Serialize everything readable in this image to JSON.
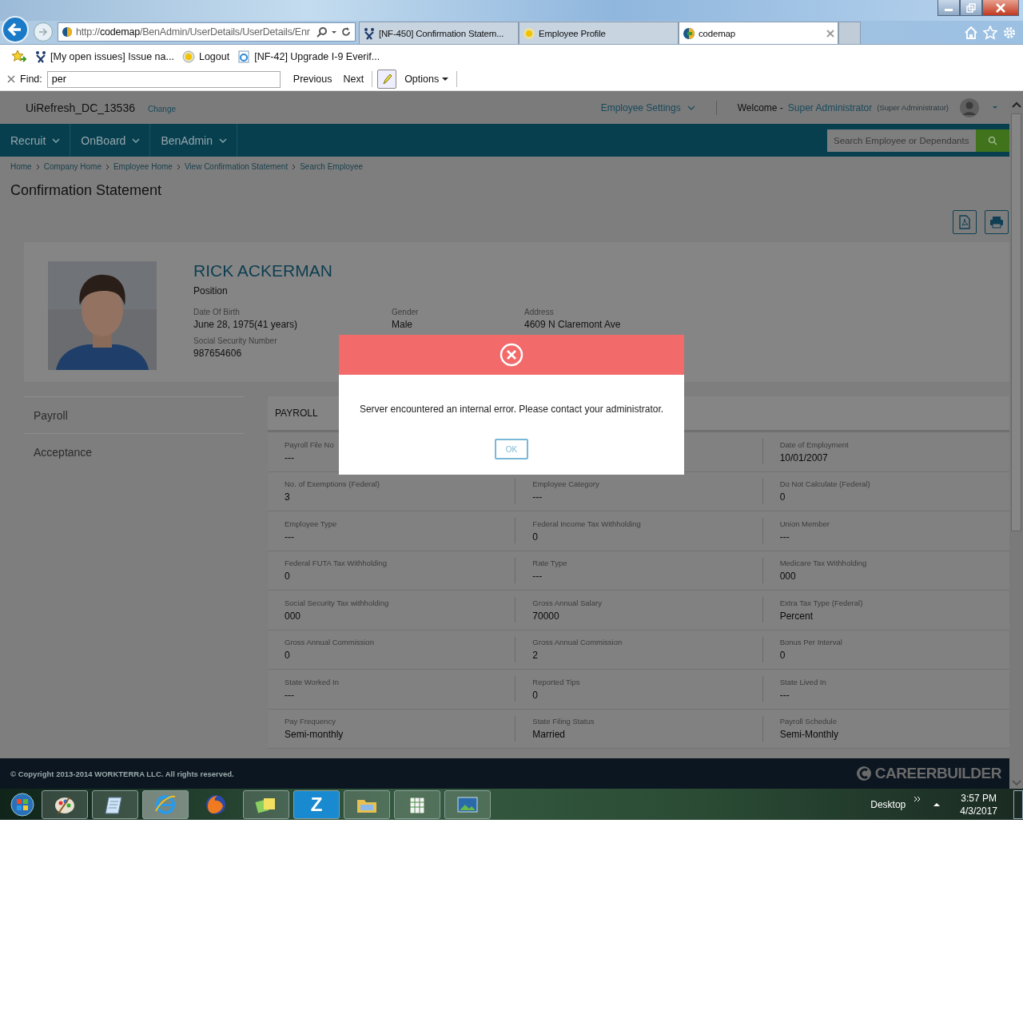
{
  "browser": {
    "address": {
      "prefix": "http://",
      "host": "codemap",
      "path": "/BenAdmin/UserDetails/UserDetails/Enr"
    },
    "tabs": [
      {
        "label": "[NF-450] Confirmation Statem...",
        "kind": "tracker",
        "selected": false
      },
      {
        "label": "Employee Profile",
        "kind": "profile",
        "selected": false
      },
      {
        "label": "codemap",
        "kind": "codemap",
        "selected": true
      }
    ],
    "favorites": [
      {
        "label": "[My open issues] Issue na...",
        "kind": "tracker"
      },
      {
        "label": "Logout",
        "kind": "profile"
      },
      {
        "label": "[NF-42] Upgrade I-9 Everif...",
        "kind": "ie"
      }
    ],
    "find": {
      "label": "Find:",
      "value": "per",
      "previous": "Previous",
      "next": "Next",
      "options": "Options"
    }
  },
  "app": {
    "company": "UiRefresh_DC_13536",
    "change": "Change",
    "settings": "Employee Settings",
    "welcome": "Welcome -",
    "user": "Super Administrator",
    "role": "(Super Administrator)",
    "nav": [
      "Recruit",
      "OnBoard",
      "BenAdmin"
    ],
    "search": {
      "placeholder": "Search Employee or Dependants"
    }
  },
  "breadcrumbs": [
    "Home",
    "Company Home",
    "Employee Home",
    "View Confirmation Statement",
    "Search Employee"
  ],
  "page_title": "Confirmation Statement",
  "profile": {
    "name": "RICK ACKERMAN",
    "position": "Position",
    "fields": [
      {
        "label": "Date Of Birth",
        "value": "June 28, 1975(41 years)"
      },
      {
        "label": "Gender",
        "value": "Male"
      },
      {
        "label": "Address",
        "value": "4609 N Claremont Ave"
      },
      {
        "label": "Social Security Number",
        "value": "987654606"
      }
    ]
  },
  "side_menu": [
    "Payroll",
    "Acceptance"
  ],
  "payroll": {
    "title": "PAYROLL",
    "rows": [
      [
        {
          "label": "Payroll File No",
          "value": "---"
        },
        "",
        {
          "label": "Date of Employment",
          "value": "10/01/2007"
        }
      ],
      [
        {
          "label": "No. of Exemptions (Federal)",
          "value": "3"
        },
        {
          "label": "Employee Category",
          "value": "---"
        },
        {
          "label": "Do Not Calculate (Federal)",
          "value": "0"
        }
      ],
      [
        {
          "label": "Employee Type",
          "value": "---"
        },
        {
          "label": "Federal Income Tax Withholding",
          "value": "0"
        },
        {
          "label": "Union Member",
          "value": "---"
        }
      ],
      [
        {
          "label": "Federal FUTA Tax Withholding",
          "value": "0"
        },
        {
          "label": "Rate Type",
          "value": "---"
        },
        {
          "label": "Medicare Tax Withholding",
          "value": "000"
        }
      ],
      [
        {
          "label": "Social Security Tax withholding",
          "value": "000"
        },
        {
          "label": "Gross Annual Salary",
          "value": "70000"
        },
        {
          "label": "Extra Tax Type (Federal)",
          "value": "Percent"
        }
      ],
      [
        {
          "label": "Gross Annual Commission",
          "value": "0"
        },
        {
          "label": "Gross Annual Commission",
          "value": "2"
        },
        {
          "label": "Bonus Per Interval",
          "value": "0"
        }
      ],
      [
        {
          "label": "State Worked In",
          "value": "---"
        },
        {
          "label": "Reported Tips",
          "value": "0"
        },
        {
          "label": "State Lived In",
          "value": "---"
        }
      ],
      [
        {
          "label": "Pay Frequency",
          "value": "Semi-monthly"
        },
        {
          "label": "State Filing Status",
          "value": "Married"
        },
        {
          "label": "Payroll Schedule",
          "value": "Semi-Monthly"
        }
      ]
    ]
  },
  "dialog": {
    "message": "Server encountered an internal error. Please contact your administrator.",
    "button": "OK"
  },
  "footer": {
    "copyright": "© Copyright 2013-2014 WORKTERRA LLC. All rights reserved.",
    "logo": "CAREERBUILDER"
  },
  "taskbar": {
    "app_letter": "Z",
    "desktop": "Desktop",
    "time": "3:57 PM",
    "date": "4/3/2017"
  }
}
